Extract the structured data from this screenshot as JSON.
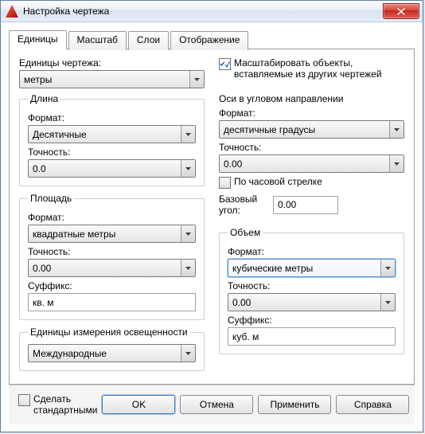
{
  "window_title": "Настройка чертежа",
  "tabs": {
    "units": "Единицы",
    "scale": "Масштаб",
    "layers": "Слои",
    "display": "Отображение"
  },
  "drawing_units": {
    "label": "Единицы чертежа:",
    "value": "метры"
  },
  "length": {
    "legend": "Длина",
    "format_label": "Формат:",
    "format_value": "Десятичные",
    "precision_label": "Точность:",
    "precision_value": "0.0"
  },
  "area": {
    "legend": "Площадь",
    "format_label": "Формат:",
    "format_value": "квадратные метры",
    "precision_label": "Точность:",
    "precision_value": "0.00",
    "suffix_label": "Суффикс:",
    "suffix_value": "кв. м"
  },
  "lighting": {
    "legend": "Единицы измерения освещенности",
    "value": "Международные"
  },
  "scale_objects": {
    "label": "Масштабировать объекты, вставляемые из других чертежей",
    "checked": true
  },
  "angular": {
    "heading": "Оси в угловом направлении",
    "format_label": "Формат:",
    "format_value": "десятичные градусы",
    "precision_label": "Точность:",
    "precision_value": "0.00",
    "clockwise_label": "По часовой стрелке",
    "clockwise_checked": false,
    "base_angle_label": "Базовый угол:",
    "base_angle_value": "0.00"
  },
  "volume": {
    "legend": "Объем",
    "format_label": "Формат:",
    "format_value": "кубические метры",
    "precision_label": "Точность:",
    "precision_value": "0.00",
    "suffix_label": "Суффикс:",
    "suffix_value": "куб. м"
  },
  "make_default": {
    "label": "Сделать стандартными",
    "checked": false
  },
  "buttons": {
    "ok": "OK",
    "cancel": "Отмена",
    "apply": "Применить",
    "help": "Справка"
  }
}
